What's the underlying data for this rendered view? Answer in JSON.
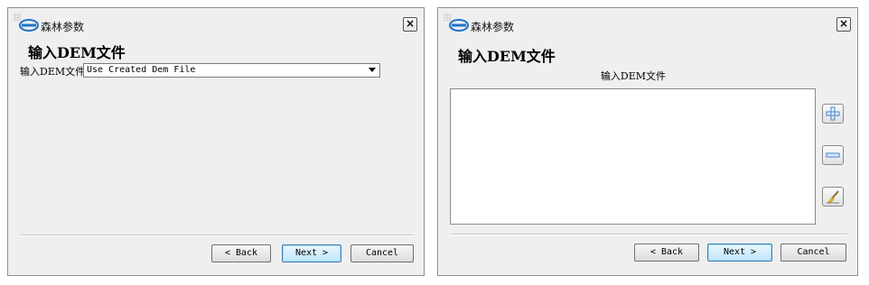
{
  "colors": {
    "logo_blue": "#1e73c8",
    "plus_blue": "#5a93d6",
    "brush_yellow": "#e8b820"
  },
  "left_dialog": {
    "title": "森林参数",
    "close_glyph": "×",
    "heading": "输入DEM文件",
    "dem_field": {
      "label": "输入DEM文件",
      "value": "Use Created Dem File"
    },
    "buttons": {
      "back": "< Back",
      "next": "Next >",
      "cancel": "Cancel"
    }
  },
  "right_dialog": {
    "title": "森林参数",
    "close_glyph": "×",
    "heading": "输入DEM文件",
    "list_title": "输入DEM文件",
    "list_items": [],
    "tools": [
      "add-icon",
      "remove-icon",
      "clear-brush-icon"
    ],
    "buttons": {
      "back": "< Back",
      "next": "Next >",
      "cancel": "Cancel"
    }
  }
}
